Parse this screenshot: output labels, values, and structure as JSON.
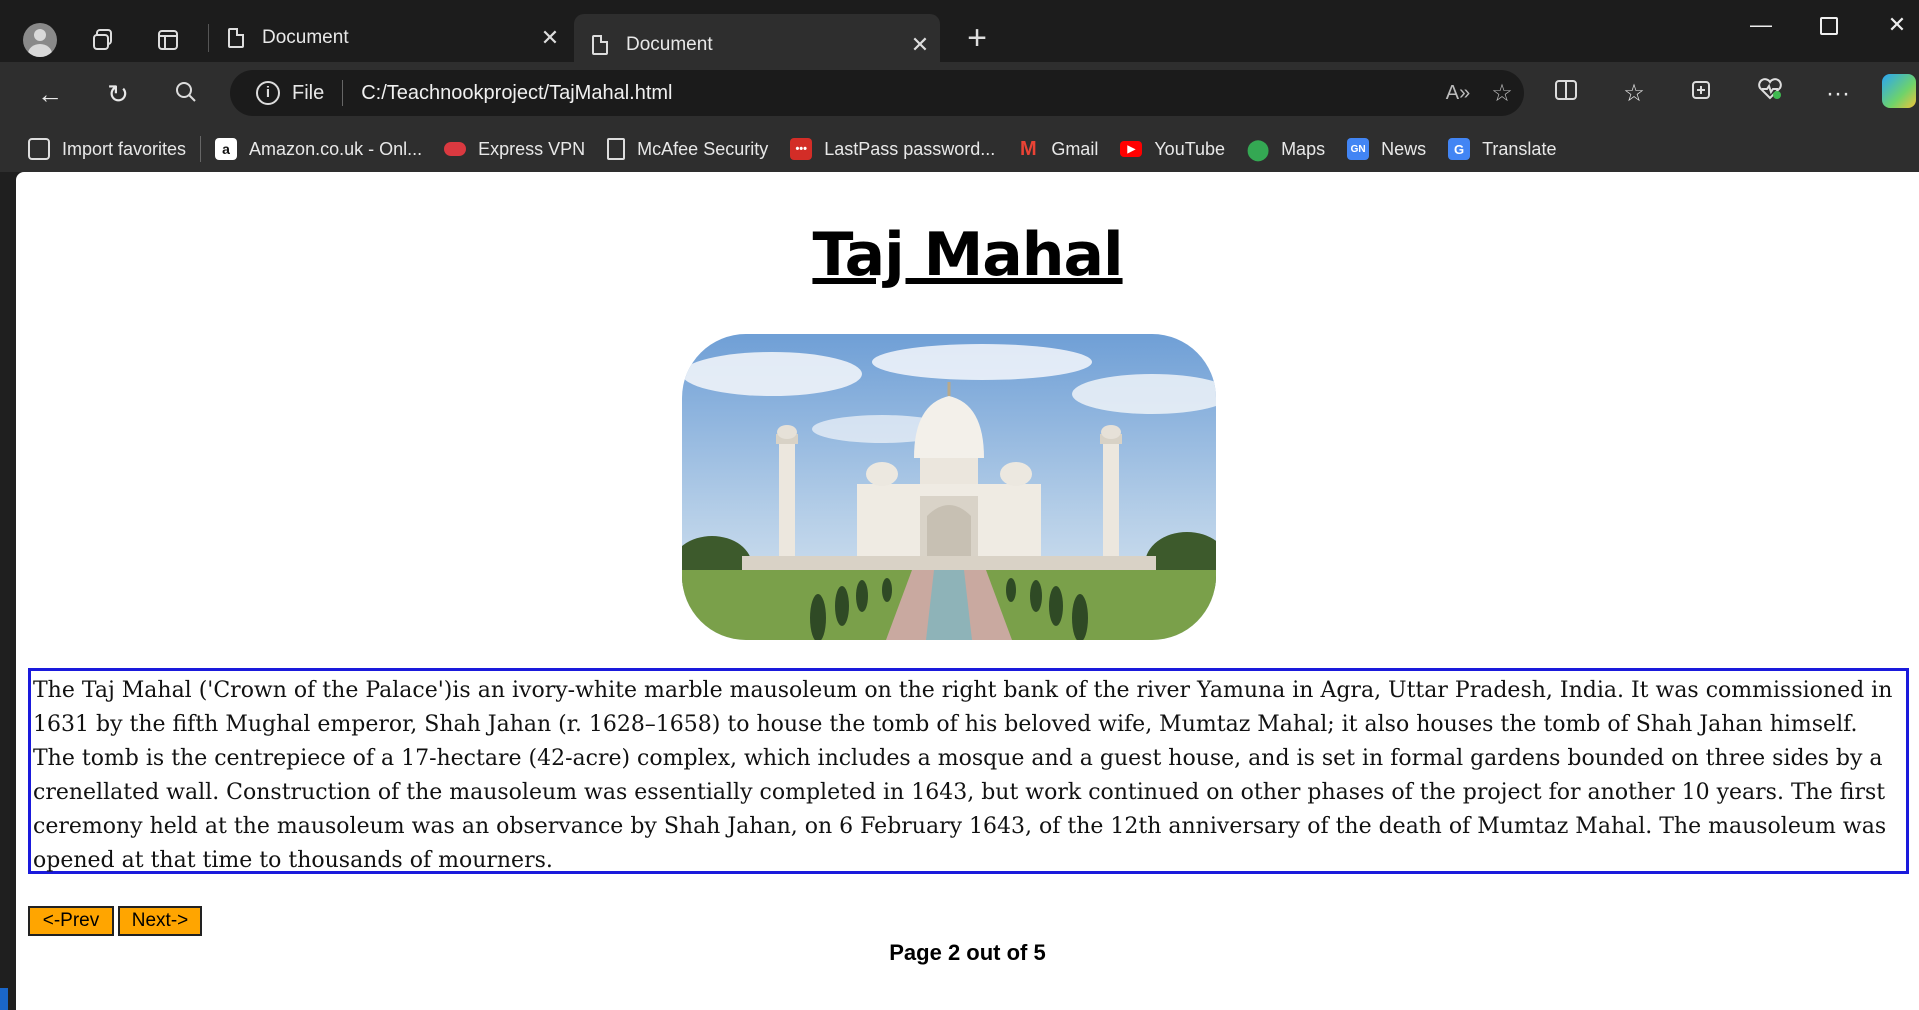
{
  "browser": {
    "tabs": [
      {
        "label": "Document",
        "active": false
      },
      {
        "label": "Document",
        "active": true
      }
    ],
    "address": {
      "scheme_label": "File",
      "url": "C:/Teachnookproject/TajMahal.html"
    },
    "favorites": [
      {
        "label": "Import favorites",
        "icon": "import-icon"
      },
      {
        "label": "Amazon.co.uk - Onl...",
        "icon": "amazon-icon"
      },
      {
        "label": "Express VPN",
        "icon": "expressvpn-icon"
      },
      {
        "label": "McAfee Security",
        "icon": "page-icon"
      },
      {
        "label": "LastPass password...",
        "icon": "lastpass-icon"
      },
      {
        "label": "Gmail",
        "icon": "gmail-icon"
      },
      {
        "label": "YouTube",
        "icon": "youtube-icon"
      },
      {
        "label": "Maps",
        "icon": "maps-icon"
      },
      {
        "label": "News",
        "icon": "news-icon"
      },
      {
        "label": "Translate",
        "icon": "translate-icon"
      }
    ]
  },
  "page": {
    "title": "Taj Mahal",
    "image_alt": "Taj Mahal photo",
    "description": "The Taj Mahal ('Crown of the Palace')is an ivory-white marble mausoleum on the right bank of the river Yamuna in Agra, Uttar Pradesh, India. It was commissioned in 1631 by the fifth Mughal emperor, Shah Jahan (r. 1628–1658) to house the tomb of his beloved wife, Mumtaz Mahal; it also houses the tomb of Shah Jahan himself. The tomb is the centrepiece of a 17-hectare (42-acre) complex, which includes a mosque and a guest house, and is set in formal gardens bounded on three sides by a crenellated wall. Construction of the mausoleum was essentially completed in 1643, but work continued on other phases of the project for another 10 years. The first ceremony held at the mausoleum was an observance by Shah Jahan, on 6 February 1643, of the 12th anniversary of the death of Mumtaz Mahal. The mausoleum was opened at that time to thousands of mourners.",
    "prev_label": "<-Prev",
    "next_label": "Next->",
    "page_info": "Page 2 out of 5"
  },
  "colors": {
    "button_bg": "#ffa500",
    "desc_border": "#1a1adc"
  }
}
